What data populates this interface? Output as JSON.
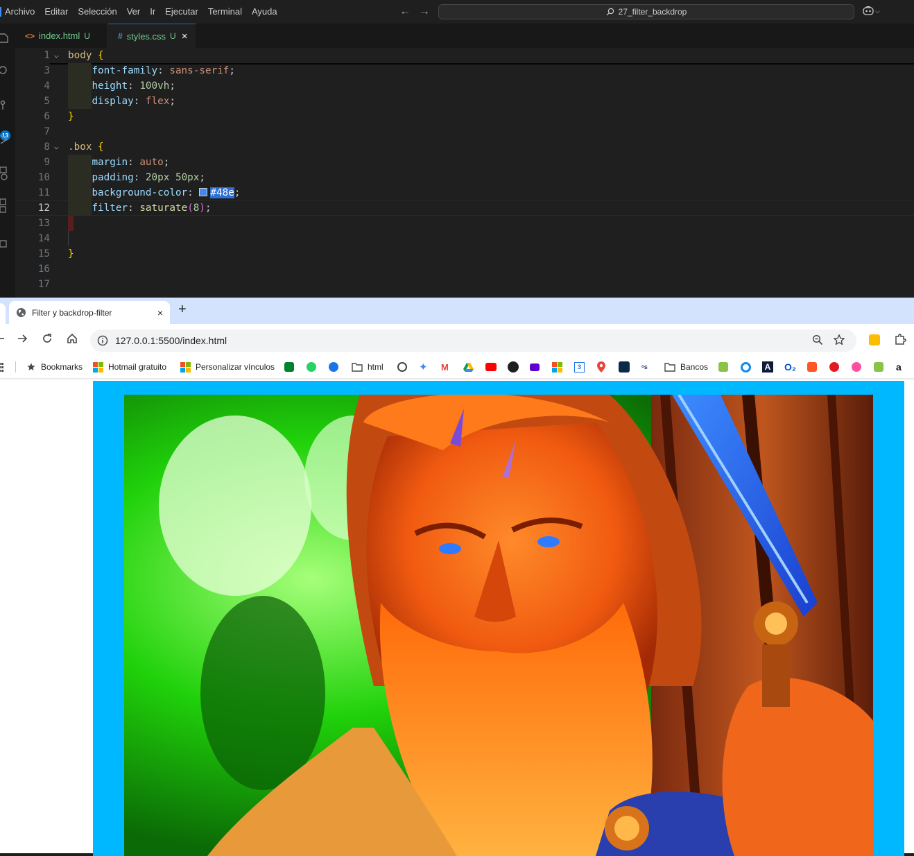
{
  "vscode": {
    "menu": [
      "Archivo",
      "Editar",
      "Selección",
      "Ver",
      "Ir",
      "Ejecutar",
      "Terminal",
      "Ayuda"
    ],
    "search_text": "27_filter_backdrop",
    "badge_count": "13",
    "tabs": [
      {
        "icon": "<>",
        "name": "index.html",
        "status": "U"
      },
      {
        "icon": "#",
        "name": "styles.css",
        "status": "U",
        "close": "×"
      }
    ],
    "line_numbers": [
      "1",
      "3",
      "4",
      "5",
      "6",
      "7",
      "8",
      "9",
      "10",
      "11",
      "12",
      "13",
      "14",
      "15",
      "16",
      "17"
    ],
    "code": {
      "l1_selector": "body",
      "brace_open": "{",
      "brace_close": "}",
      "colon": ": ",
      "semi": ";",
      "l3_prop": "font-family",
      "l3_val": "sans-serif",
      "l4_prop": "height",
      "l4_val": "100vh",
      "l5_prop": "display",
      "l5_val": "flex",
      "l8_selector": ".box",
      "l9_prop": "margin",
      "l9_val": "auto",
      "l10_prop": "padding",
      "l10_val": "20px 50px",
      "l11_prop": "background-color",
      "l11_val": "#48e",
      "l12_prop": "filter",
      "l12_fn": "saturate",
      "l12_open": "(",
      "l12_arg": "8",
      "l12_close": ")"
    },
    "colors": {
      "swatch": "#4488ee"
    }
  },
  "chrome": {
    "tab_title": "Filter y backdrop-filter",
    "tab_close": "×",
    "new_tab": "+",
    "url": "127.0.0.1:5500/index.html",
    "bookmarks": {
      "bookmarks_label": "Bookmarks",
      "hotmail": "Hotmail gratuito",
      "personalizar": "Personalizar vínculos",
      "html_folder": "html",
      "bancos": "Bancos",
      "calendar_day": "3",
      "o2": "O₂",
      "a_letter": "A"
    },
    "page": {
      "box_color": "#00b8ff",
      "image_alt": "saturated viking warrior portrait"
    }
  }
}
